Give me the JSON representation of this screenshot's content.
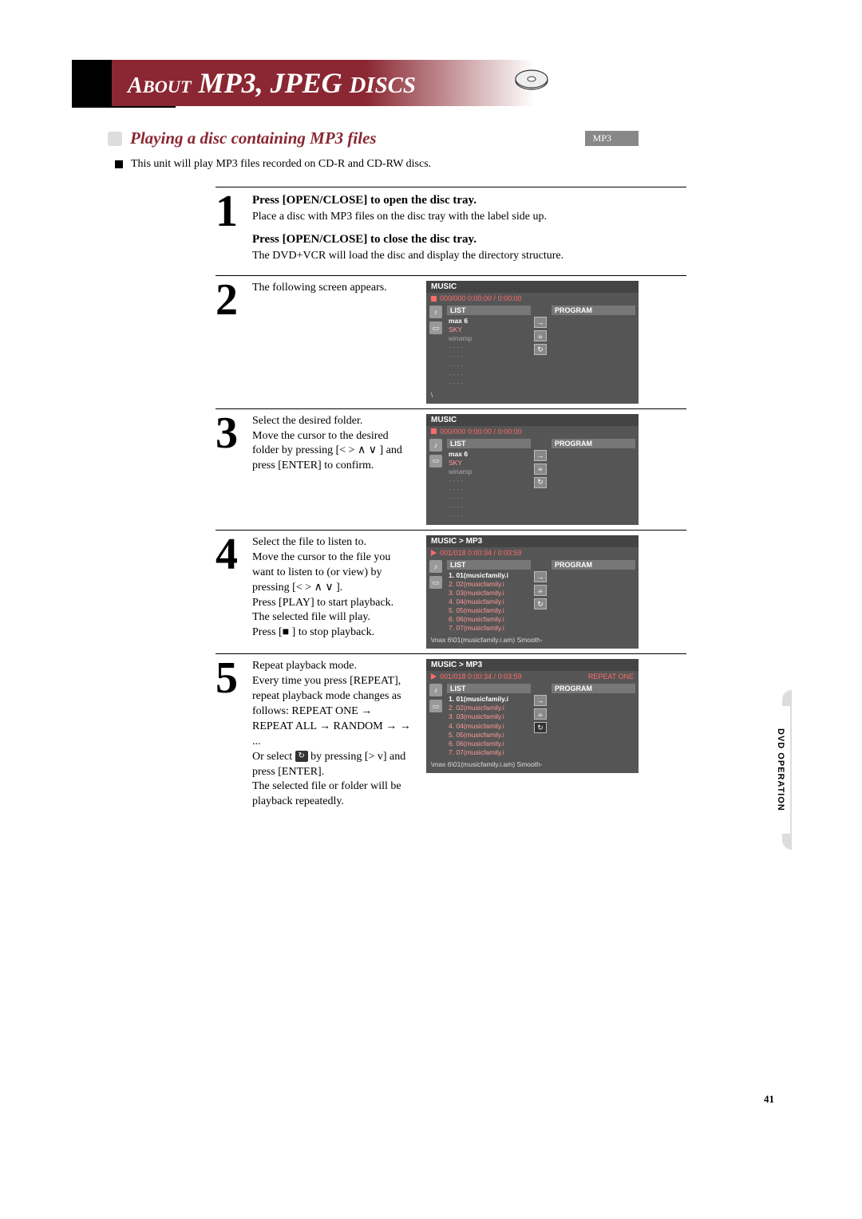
{
  "title": {
    "full": "ABOUT MP3, JPEG DISCS"
  },
  "section": {
    "title": "Playing a disc containing MP3 files",
    "badge": "MP3"
  },
  "intro": "This unit will play MP3 files recorded on CD-R and CD-RW discs.",
  "steps": {
    "s1": {
      "h1": "Press [OPEN/CLOSE] to open the disc tray.",
      "p1": "Place a disc with MP3 files on the disc tray with the label side up.",
      "h2": "Press [OPEN/CLOSE] to close the disc tray.",
      "p2": "The DVD+VCR will load the disc and display the directory structure."
    },
    "s2": {
      "p1": "The following screen appears."
    },
    "s3": {
      "h1": "Select the desired folder.",
      "p1": "Move the cursor to the desired folder by pressing  [< > ∧ ∨ ]  and press [ENTER] to confirm."
    },
    "s4": {
      "h1": "Select the file to listen to.",
      "p1": "Move the cursor to the file you want to listen to (or view) by pressing  [< > ∧ ∨ ].",
      "h2": "Press [PLAY] to start playback.",
      "p2": "The selected file will play.",
      "h3": "Press [■ ] to stop playback."
    },
    "s5": {
      "h1": "Repeat playback mode.",
      "p1": "Every time you press [REPEAT], repeat playback mode changes as follows: REPEAT ONE → REPEAT ALL → RANDOM →   → ...",
      "p2a": "Or select ",
      "p2b": " by pressing [> v] and press [ENTER].",
      "p3": "The selected file or folder will be playback repeatedly."
    }
  },
  "screens": {
    "scr2": {
      "header": "MUSIC",
      "status": "000/000 0:00:00 / 0:00:00",
      "listH": "LIST",
      "progH": "PROGRAM",
      "items": [
        "max 6",
        "SKY",
        "winamp",
        "- - - -",
        "- - - -",
        "- - - -",
        "- - - -",
        "- - - -"
      ],
      "footer": "\\"
    },
    "scr3": {
      "header": "MUSIC",
      "status": "000/000 0:00:00 / 0:00:00",
      "listH": "LIST",
      "progH": "PROGRAM",
      "items": [
        "max 6",
        "SKY",
        "winamp",
        "- - - -",
        "- - - -",
        "- - - -",
        "- - - -",
        "- - - -"
      ],
      "footer": ""
    },
    "scr4": {
      "header": "MUSIC > MP3",
      "status": "001/018 0:00:34 / 0:03:59",
      "listH": "LIST",
      "progH": "PROGRAM",
      "items": [
        "1. 01(musicfamily.i",
        "2. 02(musicfamily.i",
        "3. 03(musicfamily.i",
        "4. 04(musicfamily.i",
        "5. 05(musicfamily.i",
        "6. 06(musicfamily.i",
        "7. 07(musicfamily.i"
      ],
      "footer": "\\max 6\\01(musicfamily.i.am)   Smooth-"
    },
    "scr5": {
      "header": "MUSIC > MP3",
      "status": "001/018 0:00:34 / 0:03:59",
      "repeat": "REPEAT ONE",
      "listH": "LIST",
      "progH": "PROGRAM",
      "items": [
        "1. 01(musicfamily.i",
        "2. 02(musicfamily.i",
        "3. 03(musicfamily.i",
        "4. 04(musicfamily.i",
        "5. 05(musicfamily.i",
        "6. 06(musicfamily.i",
        "7. 07(musicfamily.i"
      ],
      "footer": "\\max 6\\01(musicfamily.i.am)   Smooth-"
    }
  },
  "sideTab": "DVD OPERATION",
  "pageNum": "41"
}
